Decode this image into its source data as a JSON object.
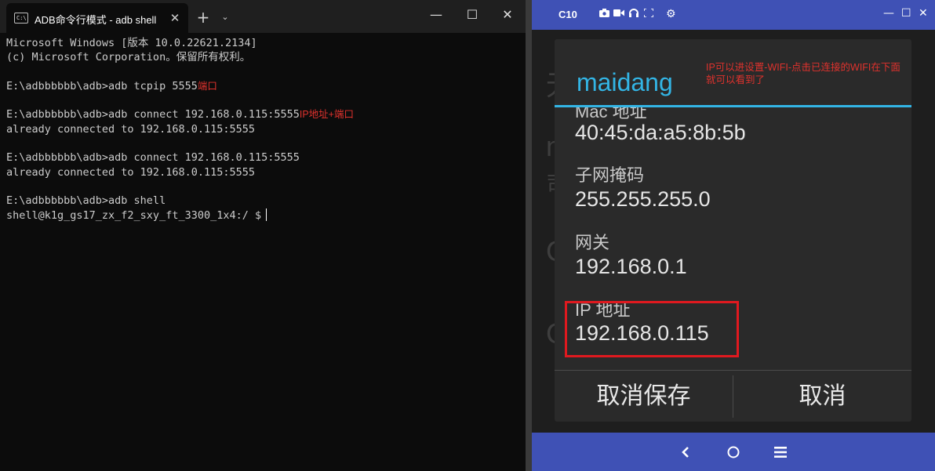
{
  "terminal": {
    "tab_title": "ADB命令行模式 - adb  shell",
    "tab_icon_text": "C:\\",
    "new_tab_label": "+",
    "tab_menu_label": "⌄",
    "window_controls": {
      "minimize": "—",
      "maximize": "☐",
      "close": "✕"
    },
    "lines": [
      {
        "text": "Microsoft Windows [版本 10.0.22621.2134]",
        "note": ""
      },
      {
        "text": "(c) Microsoft Corporation。保留所有权利。",
        "note": ""
      },
      {
        "text": "",
        "note": ""
      },
      {
        "text": "E:\\adbbbbbb\\adb>adb tcpip 5555",
        "note": "端口"
      },
      {
        "text": "",
        "note": ""
      },
      {
        "text": "E:\\adbbbbbb\\adb>adb connect 192.168.0.115:5555",
        "note": "IP地址+端口"
      },
      {
        "text": "already connected to 192.168.0.115:5555",
        "note": ""
      },
      {
        "text": "",
        "note": ""
      },
      {
        "text": "E:\\adbbbbbb\\adb>adb connect 192.168.0.115:5555",
        "note": ""
      },
      {
        "text": "already connected to 192.168.0.115:5555",
        "note": ""
      },
      {
        "text": "",
        "note": ""
      },
      {
        "text": "E:\\adbbbbbb\\adb>adb shell",
        "note": ""
      },
      {
        "text": "shell@k1g_gs17_zx_f2_sxy_ft_3300_1x4:/ $",
        "note": ""
      }
    ]
  },
  "emulator": {
    "device_name": "C10",
    "toolbar_icons": [
      "camera-icon",
      "video-icon",
      "headset-icon",
      "fullscreen-icon",
      "gear-icon"
    ],
    "window_controls": {
      "minimize": "—",
      "maximize": "☐",
      "close": "✕"
    },
    "background_chars": [
      "无",
      "n",
      "司",
      "C",
      "C"
    ],
    "dialog": {
      "title": "maidang",
      "annotation": "IP可以进设置-WIFI-点击已连接的WIFI在下面就可以看到了",
      "fields": [
        {
          "label": "Mac 地址",
          "value": "40:45:da:a5:8b:5b"
        },
        {
          "label": "子网掩码",
          "value": "255.255.255.0"
        },
        {
          "label": "网关",
          "value": "192.168.0.1"
        },
        {
          "label": "IP 地址",
          "value": "192.168.0.115"
        }
      ],
      "buttons": {
        "save_cancel": "取消保存",
        "cancel": "取消"
      }
    },
    "nav": {
      "back": "‹",
      "home": "○",
      "menu": "≡"
    }
  }
}
